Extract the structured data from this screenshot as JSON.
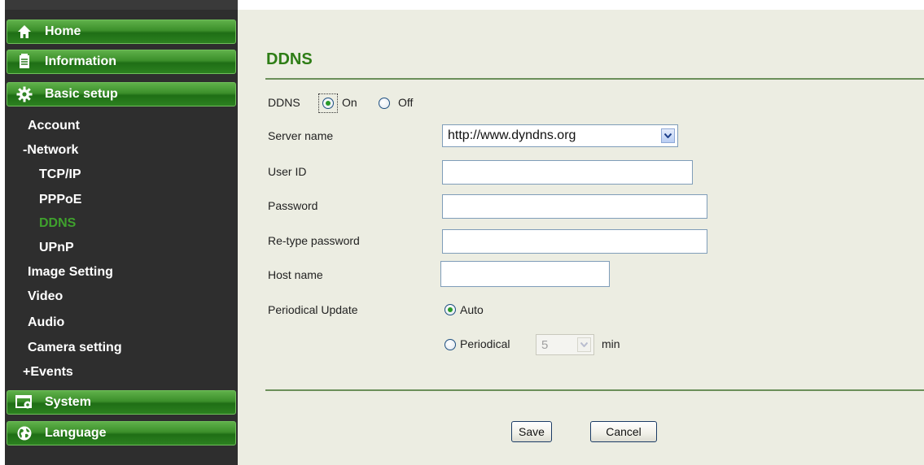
{
  "sidebar": {
    "sections": {
      "home": "Home",
      "information": "Information",
      "basic_setup": "Basic setup",
      "system": "System",
      "language": "Language"
    },
    "items": {
      "account": "Account",
      "network": "-Network",
      "tcpip": "TCP/IP",
      "pppoe": "PPPoE",
      "ddns": "DDNS",
      "upnp": "UPnP",
      "image_setting": "Image Setting",
      "video": "Video",
      "audio": "Audio",
      "camera_setting": "Camera setting",
      "events": "+Events"
    },
    "active_item": "DDNS",
    "icons": [
      "home-icon",
      "document-icon",
      "gear-icon",
      "window-gear-icon",
      "globe-icon"
    ]
  },
  "main": {
    "title": "DDNS",
    "ddns": {
      "label": "DDNS",
      "on_label": "On",
      "off_label": "Off",
      "selected": "On"
    },
    "server_name": {
      "label": "Server name",
      "value": "http://www.dyndns.org"
    },
    "user_id": {
      "label": "User ID",
      "value": ""
    },
    "password": {
      "label": "Password",
      "value": ""
    },
    "retype_password": {
      "label": "Re-type password",
      "value": ""
    },
    "host_name": {
      "label": "Host name",
      "value": ""
    },
    "periodical_update": {
      "label": "Periodical Update",
      "auto_label": "Auto",
      "periodical_label": "Periodical",
      "interval_value": "5",
      "unit": "min",
      "selected": "Auto"
    },
    "save_label": "Save",
    "cancel_label": "Cancel"
  },
  "colors": {
    "accent_green": "#2e7d16",
    "sidebar_bg": "#2e2e2e",
    "content_bg": "#ecede2",
    "active_nav": "#3fa12d"
  }
}
